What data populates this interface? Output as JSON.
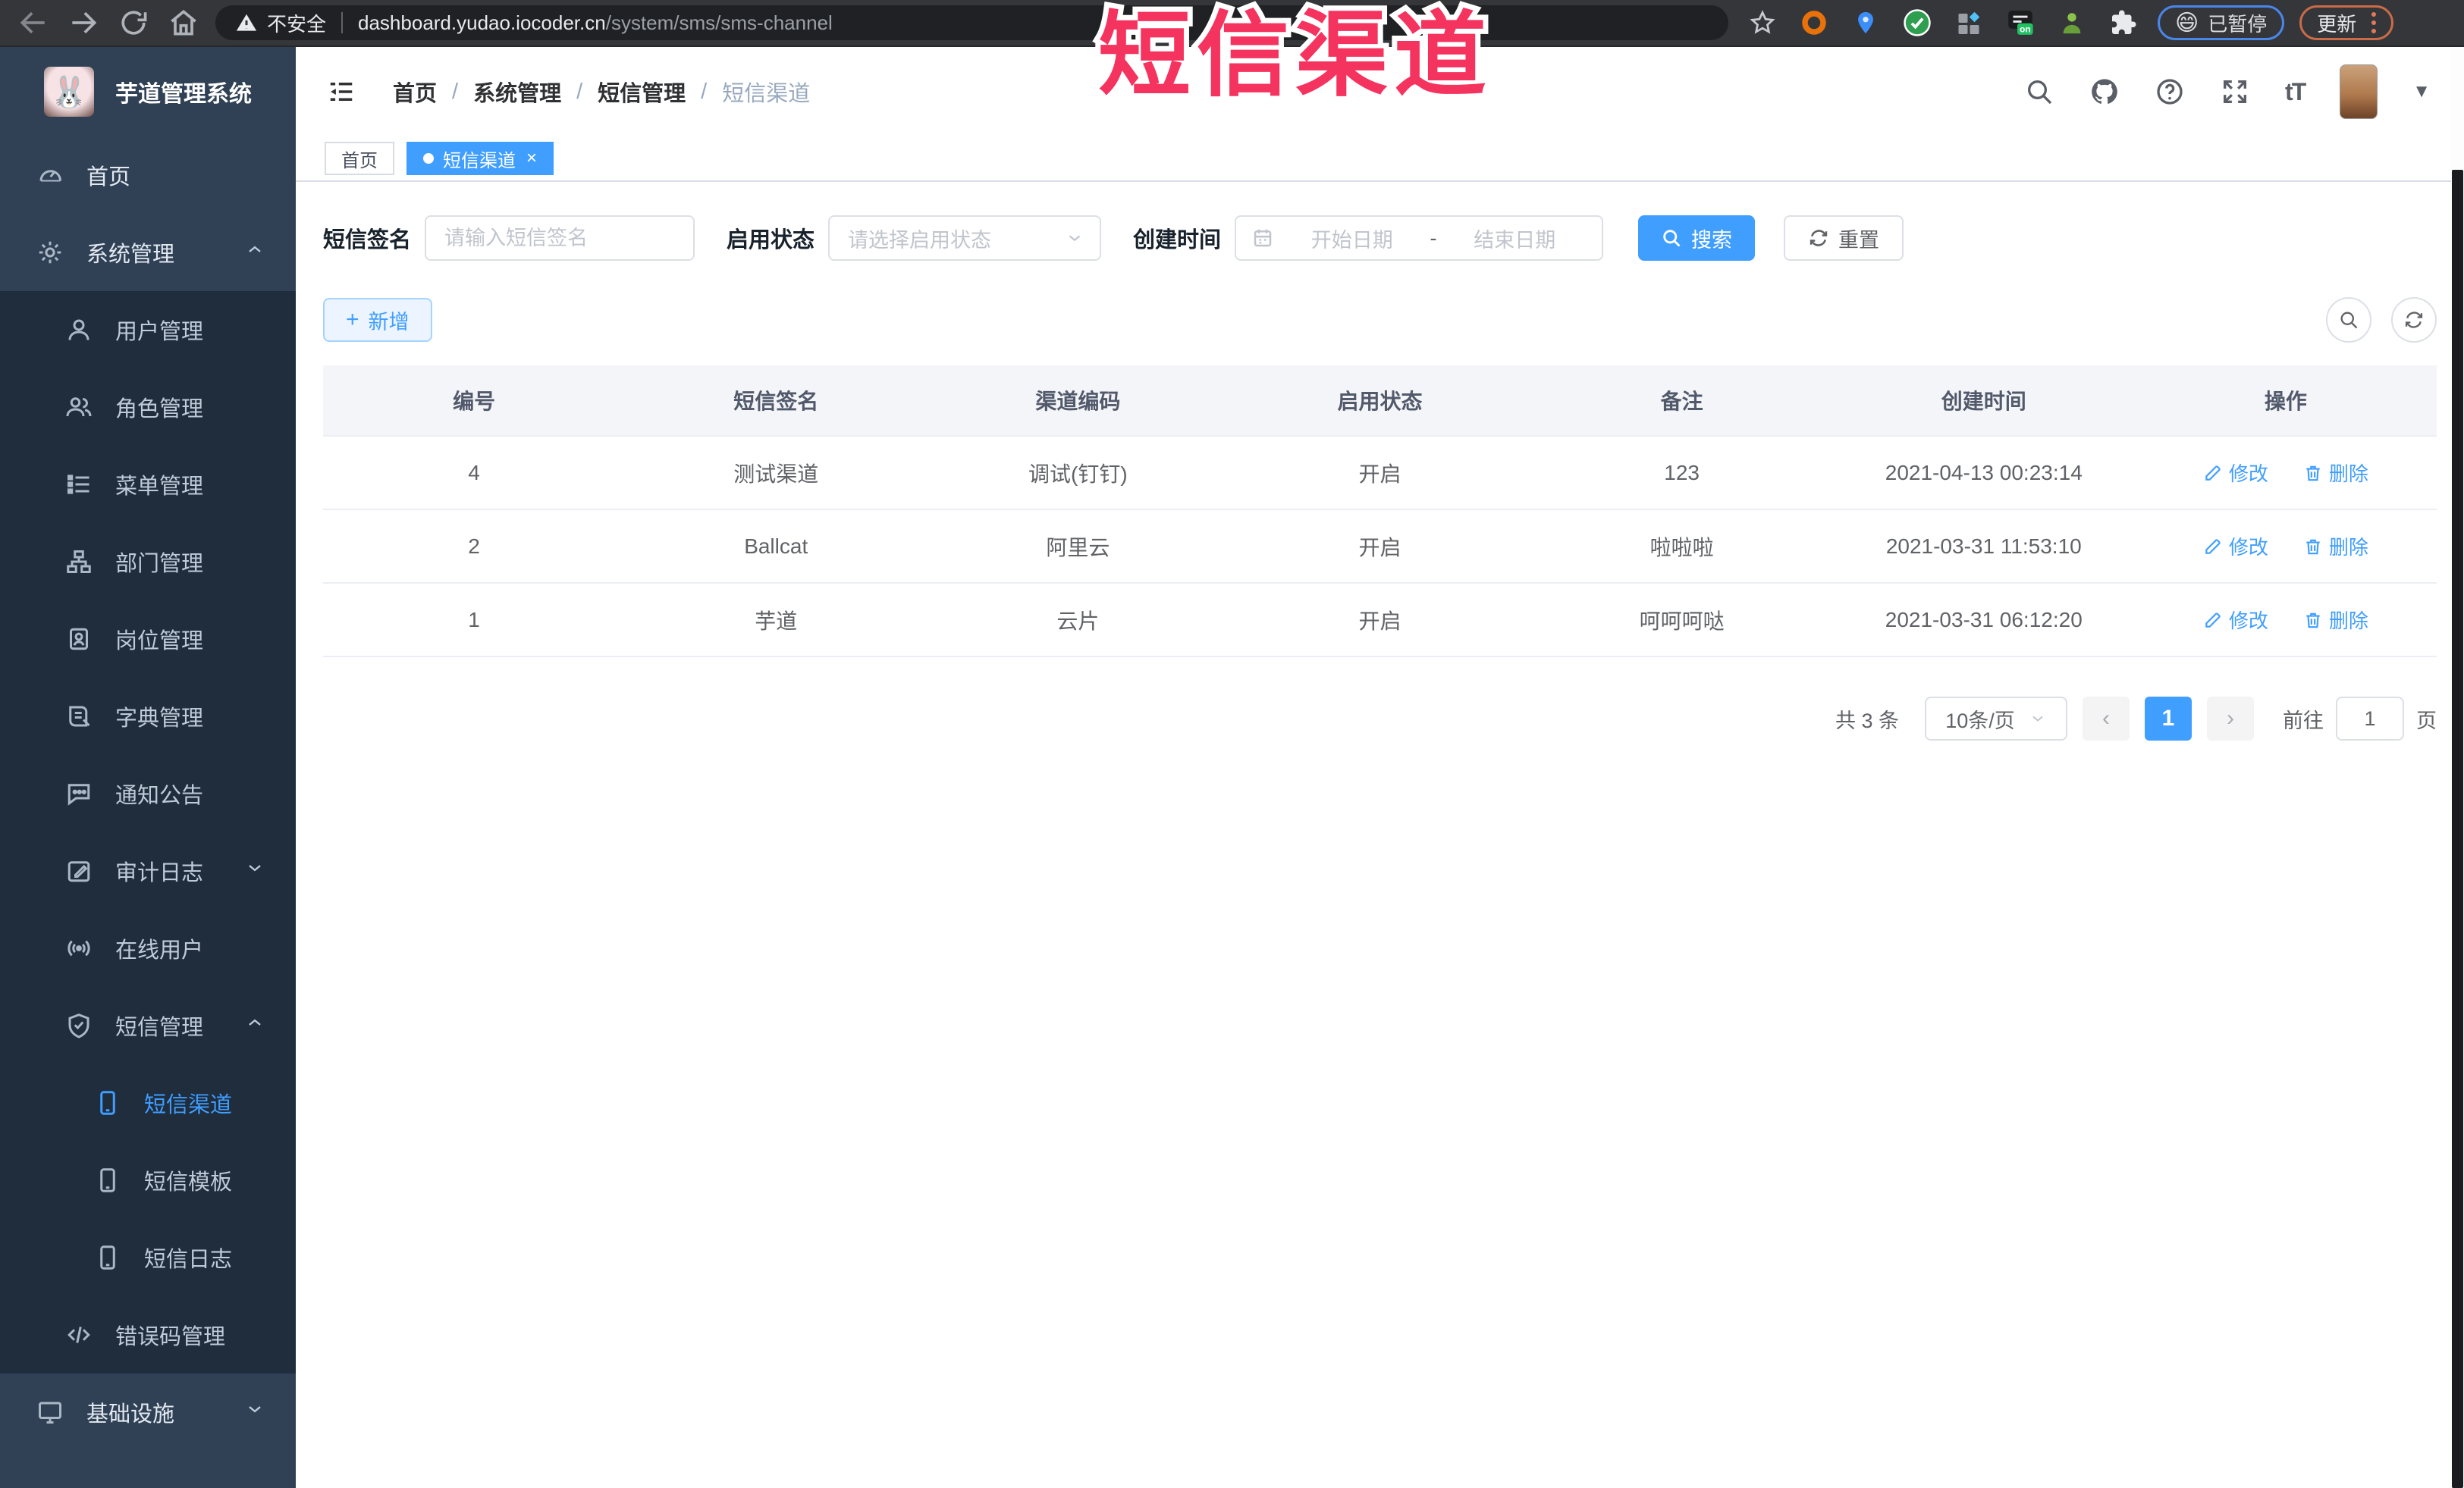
{
  "browser": {
    "security_label": "不安全",
    "url_host": "dashboard.yudao.iocoder.cn",
    "url_path": "/system/sms/sms-channel",
    "extension_on_badge": "on",
    "paused_badge": "已暂停",
    "update_button": "更新"
  },
  "watermark": "短信渠道",
  "sidebar": {
    "title": "芋道管理系统",
    "items": {
      "home": "首页",
      "system": "系统管理",
      "user": "用户管理",
      "role": "角色管理",
      "menu": "菜单管理",
      "dept": "部门管理",
      "post": "岗位管理",
      "dict": "字典管理",
      "notice": "通知公告",
      "audit": "审计日志",
      "online": "在线用户",
      "sms": "短信管理",
      "sms_channel": "短信渠道",
      "sms_template": "短信模板",
      "sms_log": "短信日志",
      "error_code": "错误码管理",
      "infra": "基础设施"
    }
  },
  "header": {
    "breadcrumb": [
      "首页",
      "系统管理",
      "短信管理",
      "短信渠道"
    ],
    "separator": "/",
    "font_size_icon": "tT"
  },
  "tabs": [
    {
      "label": "首页",
      "active": false
    },
    {
      "label": "短信渠道",
      "active": true,
      "close": "×"
    }
  ],
  "filters": {
    "signature_label": "短信签名",
    "signature_placeholder": "请输入短信签名",
    "status_label": "启用状态",
    "status_placeholder": "请选择启用状态",
    "time_label": "创建时间",
    "start_placeholder": "开始日期",
    "range_separator": "-",
    "end_placeholder": "结束日期",
    "search_button": "搜索",
    "reset_button": "重置"
  },
  "toolbar": {
    "add_button": "新增"
  },
  "table": {
    "headers": [
      "编号",
      "短信签名",
      "渠道编码",
      "启用状态",
      "备注",
      "创建时间",
      "操作"
    ],
    "rows": [
      {
        "id": "4",
        "signature": "测试渠道",
        "code": "调试(钉钉)",
        "status": "开启",
        "remark": "123",
        "created": "2021-04-13 00:23:14"
      },
      {
        "id": "2",
        "signature": "Ballcat",
        "code": "阿里云",
        "status": "开启",
        "remark": "啦啦啦",
        "created": "2021-03-31 11:53:10"
      },
      {
        "id": "1",
        "signature": "芋道",
        "code": "云片",
        "status": "开启",
        "remark": "呵呵呵哒",
        "created": "2021-03-31 06:12:20"
      }
    ],
    "edit_label": "修改",
    "delete_label": "删除"
  },
  "pagination": {
    "total": "共 3 条",
    "page_size": "10条/页",
    "prev": "‹",
    "page": "1",
    "next": "›",
    "goto_label": "前往",
    "goto_value": "1",
    "unit_label": "页"
  },
  "colors": {
    "accent": "#409eff",
    "sidebar_bg": "#304156",
    "submenu_bg": "#1f2d3d",
    "watermark_pink": "#f5335f",
    "chrome_bg": "#35363a",
    "table_header_bg": "#f4f5f8"
  }
}
